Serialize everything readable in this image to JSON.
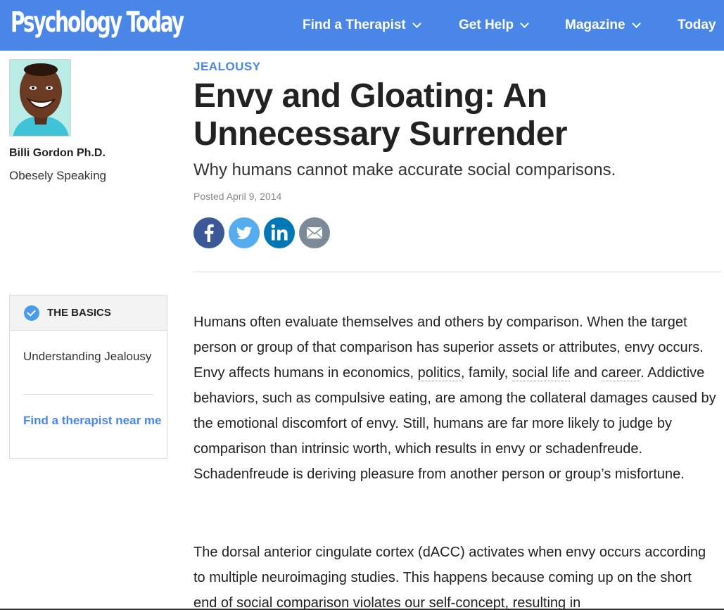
{
  "header": {
    "logo": "Psychology Today",
    "nav": [
      "Find a Therapist",
      "Get Help",
      "Magazine",
      "Today"
    ]
  },
  "author": {
    "name": "Billi Gordon Ph.D.",
    "blog": "Obesely Speaking"
  },
  "article": {
    "kicker": "JEALOUSY",
    "title": "Envy and Gloating: An Unnecessary Surrender",
    "subtitle": "Why humans cannot make accurate social comparisons.",
    "posted": "Posted April 9, 2014"
  },
  "share": [
    "facebook-icon",
    "twitter-icon",
    "linkedin-icon",
    "email-icon"
  ],
  "basics": {
    "title": "THE BASICS",
    "link1": "Understanding Jealousy",
    "link2": "Find a therapist near me"
  },
  "body": {
    "p1_a": "Humans often evaluate themselves and others by comparison. When the target person or group of that comparison has superior assets or attributes, envy occurs. Envy affects humans in economics, ",
    "p1_link_politics": "politics",
    "p1_b": ", family, ",
    "p1_link_social": "social life",
    "p1_c": " and ",
    "p1_link_career": "career",
    "p1_d": ". Addictive behaviors, such as compulsive eating, are among the collateral damages caused by the emotional discomfort of envy. Still, hu­mans are far more likely to judge by comparison than intrinsic worth, which results in envy or schadenfreude. Schadenfreude is deriving pleasure from another person or group’s misfortune.",
    "p2": "The dorsal anterior cingulate cortex (dACC) activates when envy occurs ac­cording to multiple neuroimaging studies. This happens because coming up on the short end of social comparison violates our self-concept, resulting in"
  },
  "colors": {
    "brand_blue": "#4a86e8",
    "facebook": "#3b5998",
    "twitter": "#55acee",
    "linkedin": "#0077b5",
    "email": "#7b8a96"
  }
}
